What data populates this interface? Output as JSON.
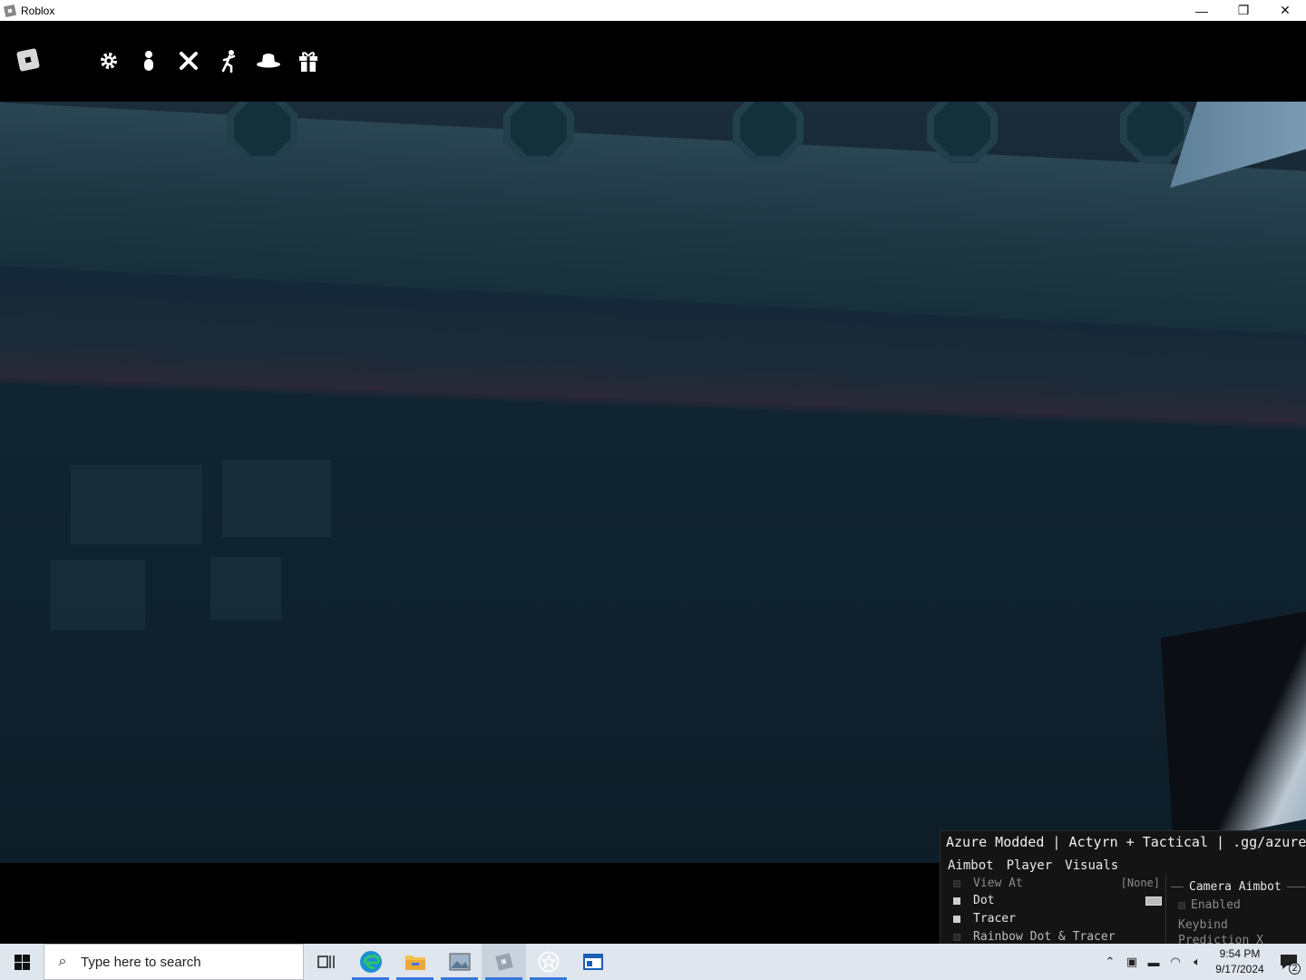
{
  "window": {
    "title": "Roblox",
    "minimize_glyph": "—",
    "restore_glyph": "❐",
    "close_glyph": "✕"
  },
  "roblox_topbar": {
    "tools": [
      {
        "name": "settings-icon"
      },
      {
        "name": "player-icon"
      },
      {
        "name": "swords-icon"
      },
      {
        "name": "emote-icon"
      },
      {
        "name": "hat-icon"
      },
      {
        "name": "gift-icon"
      }
    ]
  },
  "menu": {
    "title": "Azure Modded | Actyrn + Tactical | .gg/azuremo",
    "tabs": [
      "Aimbot",
      "Player",
      "Visuals"
    ],
    "left_options": [
      {
        "label": "View At",
        "keybind": "[None]",
        "checked": false
      },
      {
        "label": "Dot",
        "checked": true
      },
      {
        "label": "Tracer",
        "checked": true
      },
      {
        "label": "Rainbow Dot & Tracer",
        "checked": false
      }
    ],
    "right_section": {
      "title": "Camera Aimbot",
      "enabled_label": "Enabled",
      "keybind_label": "Keybind",
      "prediction_label": "Prediction X"
    }
  },
  "taskbar": {
    "search_placeholder": "Type here to search",
    "clock_time": "9:54 PM",
    "clock_date": "9/17/2024",
    "notification_count": "2",
    "apps": [
      {
        "name": "task-view-icon"
      },
      {
        "name": "edge-icon"
      },
      {
        "name": "file-explorer-icon"
      },
      {
        "name": "photos-icon"
      },
      {
        "name": "roblox-icon"
      },
      {
        "name": "star-app-icon"
      },
      {
        "name": "window-app-icon"
      }
    ]
  },
  "colors": {
    "menu_bg": "#141414",
    "taskbar_bg": "#dfe6ee",
    "accent": "#3c78d8"
  }
}
